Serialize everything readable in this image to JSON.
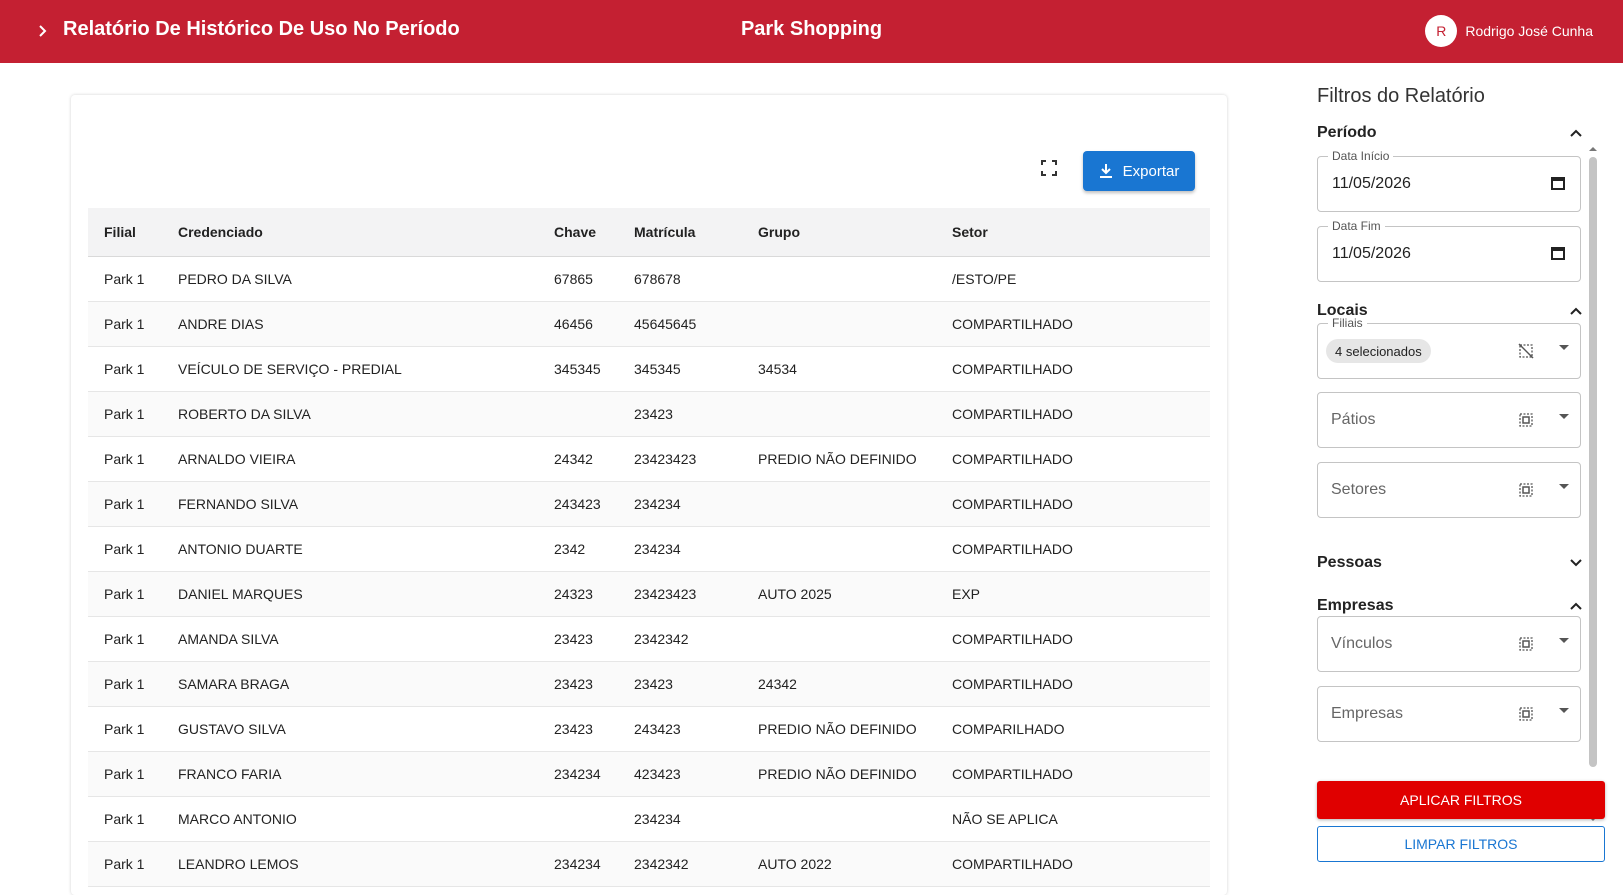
{
  "header": {
    "report_title": "Relatório De Histórico De Uso No Período",
    "center_title": "Park Shopping",
    "user_initial": "R",
    "user_name": "Rodrigo José Cunha",
    "bar_color": "#c42032"
  },
  "toolbar": {
    "export_label": "Exportar",
    "export_color": "#1976d2"
  },
  "table": {
    "columns": [
      "Filial",
      "Credenciado",
      "Chave",
      "Matrícula",
      "Grupo",
      "Setor"
    ],
    "rows": [
      [
        "Park 1",
        "PEDRO DA SILVA",
        "67865",
        "678678",
        "",
        "/ESTO/PE"
      ],
      [
        "Park 1",
        "ANDRE DIAS",
        "46456",
        "45645645",
        "",
        "COMPARTILHADO"
      ],
      [
        "Park 1",
        "VEÍCULO DE SERVIÇO - PREDIAL",
        "345345",
        "345345",
        "34534",
        "COMPARTILHADO"
      ],
      [
        "Park 1",
        "ROBERTO DA SILVA",
        "",
        "23423",
        "",
        "COMPARTILHADO"
      ],
      [
        "Park 1",
        "ARNALDO VIEIRA",
        "24342",
        "23423423",
        "PREDIO NÃO DEFINIDO",
        "COMPARTILHADO"
      ],
      [
        "Park 1",
        "FERNANDO SILVA",
        "243423",
        "234234",
        "",
        "COMPARTILHADO"
      ],
      [
        "Park 1",
        "ANTONIO DUARTE",
        "2342",
        "234234",
        "",
        "COMPARTILHADO"
      ],
      [
        "Park 1",
        "DANIEL MARQUES",
        "24323",
        "23423423",
        "AUTO 2025",
        "EXP"
      ],
      [
        "Park 1",
        "AMANDA SILVA",
        "23423",
        "2342342",
        "",
        "COMPARTILHADO"
      ],
      [
        "Park 1",
        "SAMARA BRAGA",
        "23423",
        "23423",
        "24342",
        "COMPARTILHADO"
      ],
      [
        "Park 1",
        "GUSTAVO SILVA",
        "23423",
        "243423",
        "PREDIO NÃO DEFINIDO",
        "COMPARILHADO"
      ],
      [
        "Park 1",
        "FRANCO FARIA",
        "234234",
        "423423",
        "PREDIO NÃO DEFINIDO",
        "COMPARTILHADO"
      ],
      [
        "Park 1",
        "MARCO ANTONIO",
        "",
        "234234",
        "",
        "NÃO SE APLICA"
      ],
      [
        "Park 1",
        "LEANDRO LEMOS",
        "234234",
        "2342342",
        "AUTO 2022",
        "COMPARTILHADO"
      ]
    ]
  },
  "filters": {
    "title": "Filtros do Relatório",
    "periodo": {
      "label": "Período",
      "data_inicio_label": "Data Início",
      "data_inicio_value": "11/05/2026",
      "data_fim_label": "Data Fim",
      "data_fim_value": "11/05/2026"
    },
    "locais": {
      "label": "Locais",
      "filiais_label": "Filiais",
      "filiais_chip": "4 selecionados",
      "patios_placeholder": "Pátios",
      "setores_placeholder": "Setores"
    },
    "pessoas": {
      "label": "Pessoas"
    },
    "empresas": {
      "label": "Empresas",
      "vinculos_placeholder": "Vínculos",
      "empresas_placeholder": "Empresas"
    },
    "apply_label": "APLICAR FILTROS",
    "clear_label": "LIMPAR FILTROS",
    "apply_color": "#e00000"
  }
}
